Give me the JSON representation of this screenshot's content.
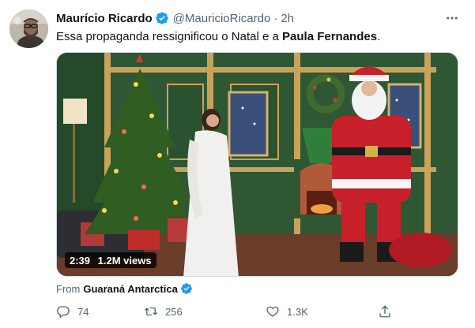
{
  "tweet": {
    "author_name": "Maurício Ricardo",
    "author_handle": "@MauricioRicardo",
    "separator": "·",
    "time": "2h",
    "text_before": "Essa propaganda ressignificou o Natal e a ",
    "text_mention": "Paula Fernandes",
    "text_after": "."
  },
  "media": {
    "duration": "2:39",
    "views": "1.2M views"
  },
  "source": {
    "prefix": "From",
    "name": "Guaraná Antarctica"
  },
  "actions": {
    "replies": "74",
    "retweets": "256",
    "likes": "1.3K"
  },
  "icons": {
    "verified": "verified-badge-icon",
    "more": "more-horizontal-icon",
    "reply": "reply-icon",
    "retweet": "retweet-icon",
    "like": "heart-icon",
    "share": "share-icon"
  },
  "colors": {
    "verified": "#1d9bf0",
    "secondary_text": "#536471",
    "primary_text": "#0f1419"
  }
}
